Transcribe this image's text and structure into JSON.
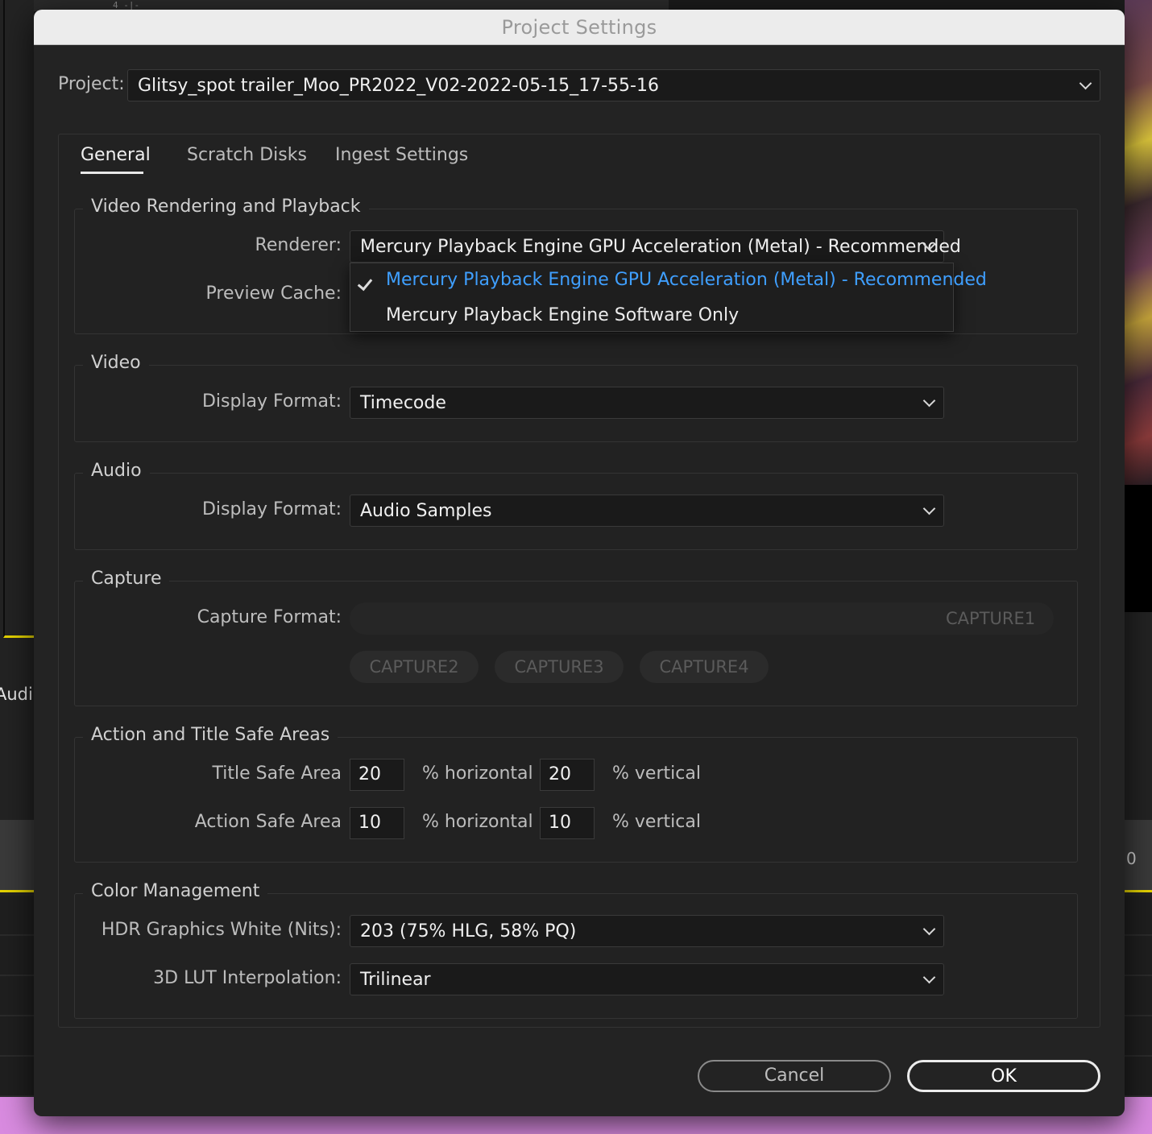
{
  "background": {
    "ruler_marks": "4 -|-",
    "left_panel_label": "Audio",
    "right_ruler_label": "0"
  },
  "dialog": {
    "title": "Project Settings",
    "project_label": "Project:",
    "project_name": "Glitsy_spot trailer_Moo_PR2022_V02-2022-05-15_17-55-16",
    "tabs": [
      {
        "label": "General",
        "active": true
      },
      {
        "label": "Scratch Disks",
        "active": false
      },
      {
        "label": "Ingest Settings",
        "active": false
      }
    ],
    "video_rendering": {
      "title": "Video Rendering and Playback",
      "renderer_label": "Renderer:",
      "renderer_value": "Mercury Playback Engine GPU Acceleration (Metal) - Recommended",
      "preview_cache_label": "Preview Cache:",
      "renderer_options": [
        {
          "label": "Mercury Playback Engine GPU Acceleration (Metal) - Recommended",
          "selected": true
        },
        {
          "label": "Mercury Playback Engine Software Only",
          "selected": false
        }
      ]
    },
    "video": {
      "title": "Video",
      "display_format_label": "Display Format:",
      "display_format_value": "Timecode"
    },
    "audio": {
      "title": "Audio",
      "display_format_label": "Display Format:",
      "display_format_value": "Audio Samples"
    },
    "capture": {
      "title": "Capture",
      "capture_format_label": "Capture Format:",
      "options": [
        "CAPTURE1",
        "CAPTURE2",
        "CAPTURE3",
        "CAPTURE4"
      ]
    },
    "safe_areas": {
      "title": "Action and Title Safe Areas",
      "title_safe_label": "Title Safe Area",
      "title_safe_horizontal": "20",
      "title_safe_vertical": "20",
      "action_safe_label": "Action Safe Area",
      "action_safe_horizontal": "10",
      "action_safe_vertical": "10",
      "horizontal_suffix": "% horizontal",
      "vertical_suffix": "% vertical"
    },
    "color_management": {
      "title": "Color Management",
      "hdr_label": "HDR Graphics White (Nits):",
      "hdr_value": "203 (75% HLG, 58% PQ)",
      "lut_label": "3D LUT Interpolation:",
      "lut_value": "Trilinear"
    },
    "buttons": {
      "cancel": "Cancel",
      "ok": "OK"
    }
  },
  "colors": {
    "dialog_bg": "#232323",
    "field_bg": "#1a1a1a",
    "selected_accent": "#3f9fff",
    "timeline_yellow": "#e5d300",
    "bottom_pink": "#d98be0"
  }
}
